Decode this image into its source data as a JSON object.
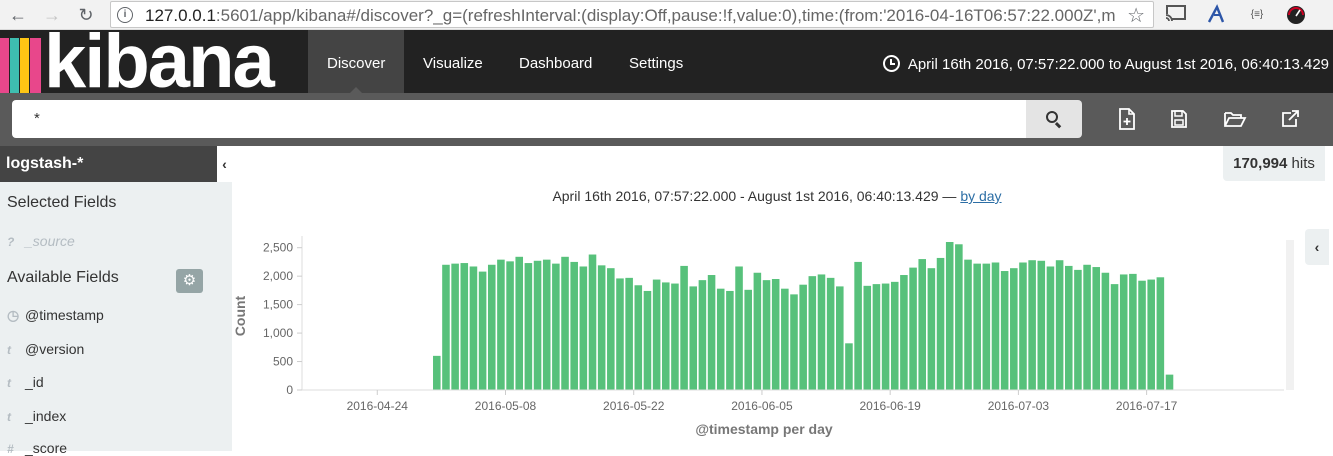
{
  "browser": {
    "url_host": "127.0.0.1",
    "url_rest": ":5601/app/kibana#/discover?_g=(refreshInterval:(display:Off,pause:!f,value:0),time:(from:'2016-04-16T06:57:22.000Z',m",
    "extension_text": "{≡}"
  },
  "nav": {
    "logo": "kibana",
    "tabs": [
      "Discover",
      "Visualize",
      "Dashboard",
      "Settings"
    ],
    "active_tab": "Discover",
    "time_range": "April 16th 2016, 07:57:22.000 to August 1st 2016, 06:40:13.429"
  },
  "search": {
    "query": "*"
  },
  "sidebar": {
    "index_pattern": "logstash-*",
    "selected_heading": "Selected Fields",
    "selected_fields": [
      {
        "type": "?",
        "name": "_source"
      }
    ],
    "available_heading": "Available Fields",
    "available_fields": [
      {
        "type": "clock",
        "name": "@timestamp"
      },
      {
        "type": "t",
        "name": "@version"
      },
      {
        "type": "t",
        "name": "_id"
      },
      {
        "type": "t",
        "name": "_index"
      },
      {
        "type": "#",
        "name": "_score"
      }
    ]
  },
  "main": {
    "hits_count": "170,994",
    "hits_label": "hits",
    "range_text": "April 16th 2016, 07:57:22.000 - August 1st 2016, 06:40:13.429 —",
    "interval_link": "by day"
  },
  "colors": {
    "bar": "#57c17b",
    "navbar": "#222222",
    "active_tab": "#444444",
    "sidebar": "#ecf0f1"
  },
  "chart_data": {
    "type": "bar",
    "xlabel": "@timestamp per day",
    "ylabel": "Count",
    "ylim": [
      0,
      2600
    ],
    "y_ticks": [
      0,
      500,
      1000,
      1500,
      2000,
      2500
    ],
    "y_tick_labels": [
      "0",
      "500",
      "1,000",
      "1,500",
      "2,000",
      "2,500"
    ],
    "x_ticks": [
      "2016-04-24",
      "2016-05-08",
      "2016-05-22",
      "2016-06-05",
      "2016-06-19",
      "2016-07-03",
      "2016-07-17"
    ],
    "x_start": "2016-04-16",
    "x_end": "2016-08-01",
    "bar_start": "2016-04-30",
    "values": [
      600,
      2200,
      2220,
      2230,
      2170,
      2080,
      2200,
      2290,
      2260,
      2340,
      2230,
      2270,
      2290,
      2220,
      2340,
      2250,
      2170,
      2380,
      2190,
      2140,
      1960,
      1970,
      1840,
      1740,
      1940,
      1890,
      1870,
      2180,
      1820,
      1930,
      2020,
      1780,
      1740,
      2170,
      1760,
      2060,
      1930,
      1950,
      1780,
      1680,
      1850,
      2000,
      2030,
      1970,
      1820,
      820,
      2250,
      1830,
      1860,
      1870,
      1900,
      2020,
      2150,
      2300,
      2140,
      2320,
      2600,
      2560,
      2290,
      2220,
      2220,
      2240,
      2090,
      2140,
      2240,
      2280,
      2270,
      2170,
      2280,
      2180,
      2110,
      2200,
      2160,
      2060,
      1860,
      2030,
      2040,
      1920,
      1940,
      1980,
      270
    ]
  }
}
